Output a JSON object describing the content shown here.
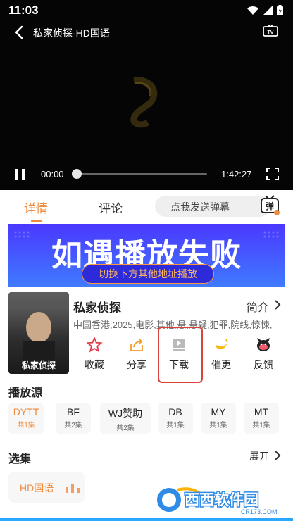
{
  "status": {
    "time": "11:03"
  },
  "player": {
    "title": "私家侦探-HD国语",
    "current_time": "00:00",
    "duration": "1:42:27",
    "progress": 0.0
  },
  "tabs": {
    "detail": "详情",
    "comment": "评论"
  },
  "danmaku": {
    "placeholder": "点我发送弹幕",
    "button": "弹"
  },
  "banner": {
    "title": "如遇播放失败",
    "subtitle": "切换下方其他地址播放"
  },
  "movie": {
    "name": "私家侦探",
    "poster_text": "私家侦探",
    "intro_label": "简介",
    "meta": "中国香港,2025,电影,其他,悬,悬疑,犯罪,院线,惊悚,"
  },
  "actions": [
    {
      "label": "收藏",
      "icon": "star-icon"
    },
    {
      "label": "分享",
      "icon": "share-icon"
    },
    {
      "label": "下载",
      "icon": "download-icon"
    },
    {
      "label": "催更",
      "icon": "banana-icon"
    },
    {
      "label": "反馈",
      "icon": "feedback-icon"
    }
  ],
  "sources_title": "播放源",
  "sources": [
    {
      "name": "DYTT",
      "count": "共1集",
      "active": true
    },
    {
      "name": "BF",
      "count": "共2集"
    },
    {
      "name": "WJ赞助",
      "count": "共2集"
    },
    {
      "name": "DB",
      "count": "共1集"
    },
    {
      "name": "MY",
      "count": "共1集"
    },
    {
      "name": "MT",
      "count": "共1集"
    }
  ],
  "episodes_title": "选集",
  "expand_label": "展开",
  "episodes": [
    {
      "label": "HD国语",
      "playing": true
    }
  ],
  "watermark": {
    "name": "西西软件园",
    "domain": "CR173.COM"
  },
  "colors": {
    "accent": "#f08a3c",
    "banner": "#4a38ff",
    "highlight": "#d9433a"
  }
}
